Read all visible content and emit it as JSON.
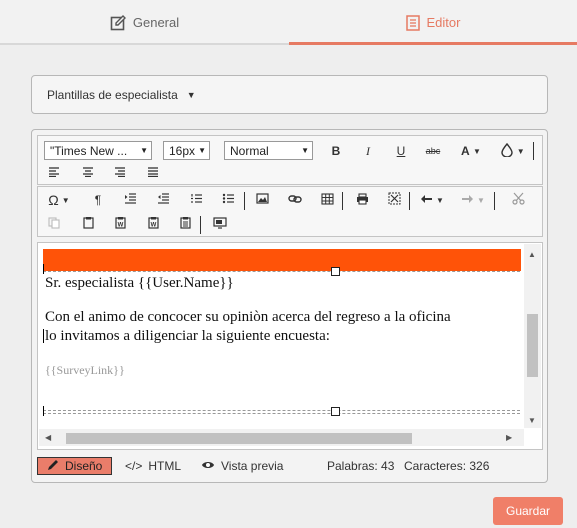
{
  "tabs": [
    {
      "label": "General",
      "icon": "edit-square-icon"
    },
    {
      "label": "Editor",
      "icon": "document-lines-icon"
    }
  ],
  "templates": {
    "label": "Plantillas de especialista"
  },
  "toolbar": {
    "font_family": "\"Times New ...",
    "font_size": "16px",
    "format": "Normal",
    "bold": "B",
    "italic": "I",
    "underline": "U",
    "strikethrough": "abc",
    "font_color": "A"
  },
  "content": {
    "greeting": "Sr. especialista {{User.Name}}",
    "line1": "Con el animo de concocer su opiniòn acerca del regreso a la oficina",
    "line2": "lo invitamos a diligenciar la siguiente encuesta:",
    "survey_link": "{{SurveyLink}}",
    "banner_color": "#ff5308"
  },
  "status": {
    "design": "Diseño",
    "html": "HTML",
    "preview": "Vista previa",
    "words": "Palabras: 43",
    "chars": "Caracteres: 326"
  },
  "actions": {
    "save": "Guardar"
  },
  "colors": {
    "accent": "#e67a62",
    "save_bg": "#f07f68"
  }
}
